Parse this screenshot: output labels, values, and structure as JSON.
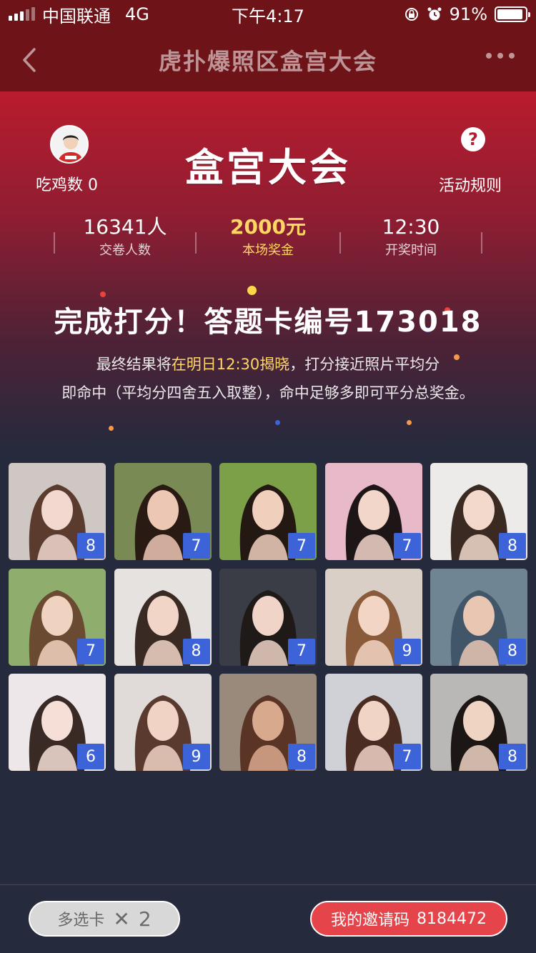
{
  "status_bar": {
    "carrier": "中国联通",
    "network": "4G",
    "time": "下午4:17",
    "battery": "91%",
    "icons": [
      "signal-icon",
      "rotation-lock-icon",
      "alarm-icon",
      "battery-icon"
    ]
  },
  "nav": {
    "title": "虎扑爆照区盒宫大会",
    "back_icon": "chevron-left-icon",
    "more_icon": "more-dots-icon"
  },
  "header": {
    "chicken_label": "吃鸡数 0",
    "logo_text": "盒宫大会",
    "rules_label": "活动规则",
    "help_icon": "?"
  },
  "stats": [
    {
      "value": "16341人",
      "label": "交卷人数"
    },
    {
      "value": "2000元",
      "label": "本场奖金"
    },
    {
      "value": "12:30",
      "label": "开奖时间"
    }
  ],
  "result": {
    "title": "完成打分！答题卡编号173018",
    "desc_line1_a": "最终结果将",
    "desc_line1_hl": "在明日12:30揭晓",
    "desc_line1_b": "，打分接近照片平均分",
    "desc_line2": "即命中（平均分四舍五入取整），命中足够多即可平分总奖金。"
  },
  "photos": [
    {
      "score": "8",
      "bg": "#cfc7c3",
      "hair": "#5a3b2e",
      "skin": "#f1d9cf"
    },
    {
      "score": "7",
      "bg": "#7a8a55",
      "hair": "#2a1a14",
      "skin": "#ecc7b4"
    },
    {
      "score": "7",
      "bg": "#7ba048",
      "hair": "#231812",
      "skin": "#f0d0bd"
    },
    {
      "score": "7",
      "bg": "#e8b9c9",
      "hair": "#1e1616",
      "skin": "#f3d6ca"
    },
    {
      "score": "8",
      "bg": "#ecebe9",
      "hair": "#3b2a22",
      "skin": "#f2d9cc"
    },
    {
      "score": "7",
      "bg": "#8fae6e",
      "hair": "#6b4a32",
      "skin": "#f0d2c1"
    },
    {
      "score": "8",
      "bg": "#e6e2df",
      "hair": "#3a2a24",
      "skin": "#f1d6c8"
    },
    {
      "score": "7",
      "bg": "#3a3d45",
      "hair": "#1f1a18",
      "skin": "#efd4c7"
    },
    {
      "score": "9",
      "bg": "#d9cfc7",
      "hair": "#8a5b3a",
      "skin": "#f3d5c5"
    },
    {
      "score": "8",
      "bg": "#6f8594",
      "hair": "#42566a",
      "skin": "#e8c6b2"
    },
    {
      "score": "6",
      "bg": "#eee7ea",
      "hair": "#3a2a26",
      "skin": "#f5dfd6"
    },
    {
      "score": "9",
      "bg": "#e0dbd9",
      "hair": "#5a3a2e",
      "skin": "#f1d3c6"
    },
    {
      "score": "8",
      "bg": "#9a8a7c",
      "hair": "#5a3424",
      "skin": "#d9a98d"
    },
    {
      "score": "7",
      "bg": "#cfd1d6",
      "hair": "#4a2c22",
      "skin": "#f0d4c6"
    },
    {
      "score": "8",
      "bg": "#b9b8b6",
      "hair": "#1c1614",
      "skin": "#efd3c3"
    }
  ],
  "bottom": {
    "multi_card_label": "多选卡",
    "multi_card_x": "✕",
    "multi_card_count": "2",
    "invite_label": "我的邀请码",
    "invite_code": "8184472"
  }
}
